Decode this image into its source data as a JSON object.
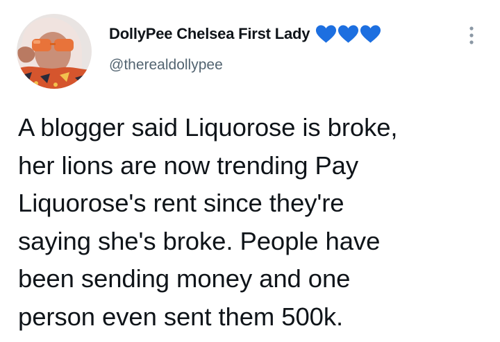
{
  "user": {
    "display_name": "DollyPee Chelsea First Lady",
    "name_emoji": [
      "blue-heart-icon",
      "blue-heart-icon",
      "blue-heart-icon"
    ],
    "handle": "@therealdollypee",
    "avatar": "profile-photo"
  },
  "menu": {
    "icon": "more-vertical-icon"
  },
  "tweet": {
    "lines": [
      "A blogger said Liquorose is broke,",
      "her lions are now trending Pay",
      "Liquorose's rent since they're",
      "saying she's broke. People have",
      "been sending money and one",
      "person even sent them 500k."
    ]
  },
  "colors": {
    "text_primary": "#0f1419",
    "text_secondary": "#536471",
    "heart_blue": "#1d6fe0",
    "background": "#ffffff"
  }
}
